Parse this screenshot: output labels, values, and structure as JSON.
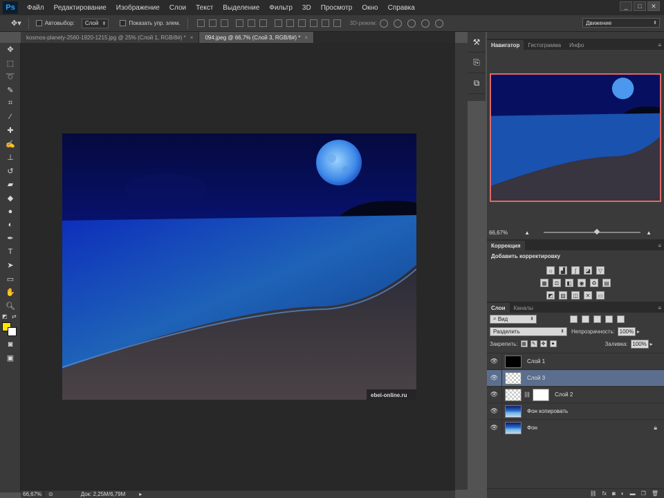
{
  "menubar": {
    "logo": "Ps",
    "items": [
      "Файл",
      "Редактирование",
      "Изображение",
      "Слои",
      "Текст",
      "Выделение",
      "Фильтр",
      "3D",
      "Просмотр",
      "Окно",
      "Справка"
    ],
    "win_min": "_",
    "win_max": "□",
    "win_close": "✕"
  },
  "options": {
    "autoselect_label": "Автовыбор:",
    "autoselect_value": "Слой",
    "show_controls_label": "Показать упр. элем.",
    "mode3d_label": "3D-режим:"
  },
  "workspace": {
    "value": "Движение"
  },
  "tabs": [
    {
      "label": "kosmos-planety-2560-1920-1215.jpg @ 25% (Слой 1, RGB/8#) *",
      "close": "×"
    },
    {
      "label": "094.jpeg @ 66,7% (Слой 3, RGB/8#) *",
      "close": "×"
    }
  ],
  "canvas": {
    "watermark": "ebei-online.ru"
  },
  "navigator": {
    "tabs": [
      "Навигатор",
      "Гистограмма",
      "Инфо"
    ],
    "zoom": "66,67%",
    "zoom_level_fraction": 0.55
  },
  "correction": {
    "tab": "Коррекция",
    "title": "Добавить корректировку"
  },
  "layers_panel": {
    "tabs": [
      "Слои",
      "Каналы"
    ],
    "filter_value": "Вид",
    "blend_mode": "Разделить",
    "opacity_label": "Непрозрачность:",
    "opacity_value": "100%",
    "lock_label": "Закрепить:",
    "fill_label": "Заливка:",
    "fill_value": "100%",
    "layers": [
      {
        "name": "Слой 1",
        "thumb": "black",
        "selected": false
      },
      {
        "name": "Слой 3",
        "thumb": "transparent",
        "selected": true
      },
      {
        "name": "Слой 2",
        "thumb": "transparent",
        "mask": "white",
        "selected": false
      },
      {
        "name": "Фон копировать",
        "thumb": "photo",
        "selected": false
      },
      {
        "name": "Фон",
        "thumb": "photo",
        "locked": true,
        "selected": false
      }
    ],
    "footer_icons": [
      "link-icon",
      "fx-icon",
      "mask-icon",
      "adjustment-icon",
      "group-icon",
      "new-layer-icon",
      "trash-icon"
    ],
    "footer_fx": "fx"
  },
  "status": {
    "zoom": "66,67%",
    "doc": "Док: 2,25M/6,79M"
  },
  "colors": {
    "foreground": "#ffe600",
    "background": "#ffffff",
    "selection": "#5b6e8e",
    "navigator_frame": "#e06a6a"
  }
}
